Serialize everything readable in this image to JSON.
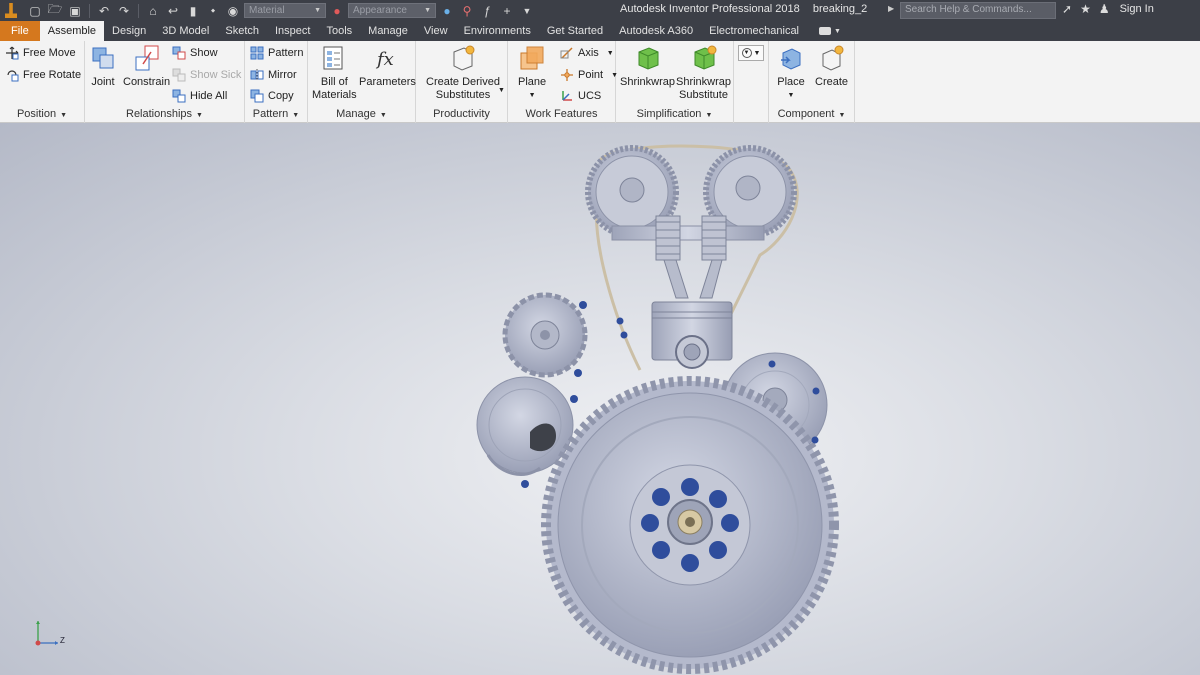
{
  "titlebar": {
    "app_title": "Autodesk Inventor Professional 2018",
    "document_name": "breaking_2",
    "search_placeholder": "Search Help & Commands...",
    "sign_in": "Sign In",
    "material_combo": "Material",
    "appearance_combo": "Appearance"
  },
  "tabs": [
    {
      "label": "File"
    },
    {
      "label": "Assemble"
    },
    {
      "label": "Design"
    },
    {
      "label": "3D Model"
    },
    {
      "label": "Sketch"
    },
    {
      "label": "Inspect"
    },
    {
      "label": "Tools"
    },
    {
      "label": "Manage"
    },
    {
      "label": "View"
    },
    {
      "label": "Environments"
    },
    {
      "label": "Get Started"
    },
    {
      "label": "Autodesk A360"
    },
    {
      "label": "Electromechanical"
    }
  ],
  "ribbon": {
    "position": {
      "title": "Position",
      "free_move": "Free Move",
      "free_rotate": "Free Rotate"
    },
    "relationships": {
      "title": "Relationships",
      "joint": "Joint",
      "constrain": "Constrain",
      "show": "Show",
      "show_sick": "Show Sick",
      "hide_all": "Hide All"
    },
    "pattern": {
      "title": "Pattern",
      "pattern": "Pattern",
      "mirror": "Mirror",
      "copy": "Copy"
    },
    "manage": {
      "title": "Manage",
      "bom_line1": "Bill of",
      "bom_line2": "Materials",
      "parameters": "Parameters"
    },
    "productivity": {
      "title": "Productivity",
      "line1": "Create Derived",
      "line2": "Substitutes"
    },
    "work_features": {
      "title": "Work Features",
      "plane": "Plane",
      "axis": "Axis",
      "point": "Point",
      "ucs": "UCS"
    },
    "simplification": {
      "title": "Simplification",
      "shrinkwrap": "Shrinkwrap",
      "sws_line1": "Shrinkwrap",
      "sws_line2": "Substitute"
    },
    "component": {
      "title": "Component",
      "place": "Place",
      "create": "Create"
    }
  },
  "viewport": {
    "triad_axis_label": "Z"
  },
  "colors": {
    "titlebar_bg": "#3c3f47",
    "file_tab": "#d5781e",
    "ribbon_bg": "#f3f3f3",
    "part_fill": "#b8bdd0",
    "bolt_blue": "#2f4d9c"
  }
}
